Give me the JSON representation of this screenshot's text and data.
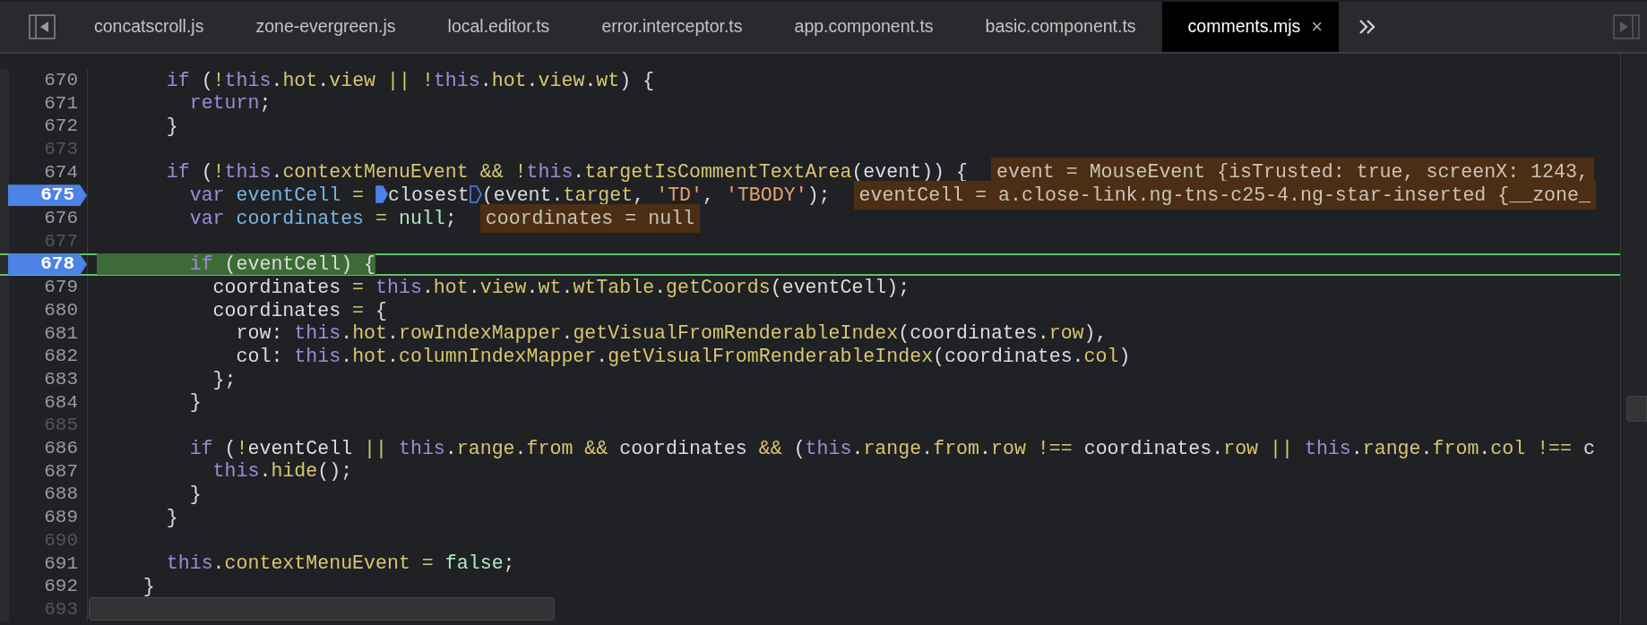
{
  "tabs": [
    {
      "label": "concatscroll.js",
      "selected": false
    },
    {
      "label": "zone-evergreen.js",
      "selected": false
    },
    {
      "label": "local.editor.ts",
      "selected": false
    },
    {
      "label": "error.interceptor.ts",
      "selected": false
    },
    {
      "label": "app.component.ts",
      "selected": false
    },
    {
      "label": "basic.component.ts",
      "selected": false
    },
    {
      "label": "comments.mjs",
      "selected": true,
      "close": "×"
    }
  ],
  "lines": [
    {
      "number": "670",
      "breakpoint": false,
      "current": false,
      "tokens": [
        {
          "kind": "keyword",
          "text": "      if"
        },
        {
          "kind": "plain",
          "text": " ("
        },
        {
          "kind": "operator",
          "text": "!"
        },
        {
          "kind": "keyword",
          "text": "this"
        },
        {
          "kind": "plain",
          "text": "."
        },
        {
          "kind": "property",
          "text": "hot"
        },
        {
          "kind": "plain",
          "text": "."
        },
        {
          "kind": "property",
          "text": "view"
        },
        {
          "kind": "operator",
          "text": " || !"
        },
        {
          "kind": "keyword",
          "text": "this"
        },
        {
          "kind": "plain",
          "text": "."
        },
        {
          "kind": "property",
          "text": "hot"
        },
        {
          "kind": "plain",
          "text": "."
        },
        {
          "kind": "property",
          "text": "view"
        },
        {
          "kind": "plain",
          "text": "."
        },
        {
          "kind": "property",
          "text": "wt"
        },
        {
          "kind": "plain",
          "text": ") {"
        }
      ]
    },
    {
      "number": "671",
      "breakpoint": false,
      "current": false,
      "tokens": [
        {
          "kind": "keyword",
          "text": "        return"
        },
        {
          "kind": "plain",
          "text": ";"
        }
      ]
    },
    {
      "number": "672",
      "breakpoint": false,
      "current": false,
      "tokens": [
        {
          "kind": "plain",
          "text": "      }"
        }
      ]
    },
    {
      "number": "673",
      "breakpoint": false,
      "current": false
    },
    {
      "number": "674",
      "breakpoint": false,
      "current": false,
      "tokens": [
        {
          "kind": "keyword",
          "text": "      if"
        },
        {
          "kind": "plain",
          "text": " ("
        },
        {
          "kind": "operator",
          "text": "!"
        },
        {
          "kind": "keyword",
          "text": "this"
        },
        {
          "kind": "plain",
          "text": "."
        },
        {
          "kind": "property",
          "text": "contextMenuEvent"
        },
        {
          "kind": "operator",
          "text": " && !"
        },
        {
          "kind": "keyword",
          "text": "this"
        },
        {
          "kind": "plain",
          "text": "."
        },
        {
          "kind": "property",
          "text": "targetIsCommentTextArea"
        },
        {
          "kind": "plain",
          "text": "(event)) {"
        }
      ],
      "value": "event = MouseEvent {isTrusted: true, screenX: 1243,"
    },
    {
      "number": "675",
      "breakpoint": true,
      "current": false,
      "tokens": [
        {
          "kind": "keyword",
          "text": "        var "
        },
        {
          "kind": "declaration",
          "text": "eventCell"
        },
        {
          "kind": "operator",
          "text": " = "
        },
        {
          "kind": "inline_breakpoint",
          "active": true
        },
        {
          "kind": "plain",
          "text": "closest"
        },
        {
          "kind": "inline_breakpoint",
          "active": false
        },
        {
          "kind": "plain",
          "text": "(event."
        },
        {
          "kind": "property",
          "text": "target"
        },
        {
          "kind": "plain",
          "text": ", "
        },
        {
          "kind": "string",
          "text": "'TD'"
        },
        {
          "kind": "plain",
          "text": ", "
        },
        {
          "kind": "string",
          "text": "'TBODY'"
        },
        {
          "kind": "plain",
          "text": ");"
        }
      ],
      "value": "eventCell = a.close-link.ng-tns-c25-4.ng-star-inserted {__zone_"
    },
    {
      "number": "676",
      "breakpoint": false,
      "current": false,
      "tokens": [
        {
          "kind": "keyword",
          "text": "        var "
        },
        {
          "kind": "declaration",
          "text": "coordinates"
        },
        {
          "kind": "operator",
          "text": " = "
        },
        {
          "kind": "literal",
          "text": "null"
        },
        {
          "kind": "plain",
          "text": ";"
        }
      ],
      "value": "coordinates = null"
    },
    {
      "number": "677",
      "breakpoint": false,
      "current": false
    },
    {
      "number": "678",
      "breakpoint": true,
      "current": true,
      "tokens": [
        {
          "kind": "keyword",
          "text": "        if"
        },
        {
          "kind": "plain",
          "text": " (eventCell) {"
        }
      ]
    },
    {
      "number": "679",
      "breakpoint": false,
      "current": false,
      "tokens": [
        {
          "kind": "plain",
          "text": "          coordinates "
        },
        {
          "kind": "operator",
          "text": "= "
        },
        {
          "kind": "keyword",
          "text": "this"
        },
        {
          "kind": "plain",
          "text": "."
        },
        {
          "kind": "property",
          "text": "hot"
        },
        {
          "kind": "plain",
          "text": "."
        },
        {
          "kind": "property",
          "text": "view"
        },
        {
          "kind": "plain",
          "text": "."
        },
        {
          "kind": "property",
          "text": "wt"
        },
        {
          "kind": "plain",
          "text": "."
        },
        {
          "kind": "property",
          "text": "wtTable"
        },
        {
          "kind": "plain",
          "text": "."
        },
        {
          "kind": "property",
          "text": "getCoords"
        },
        {
          "kind": "plain",
          "text": "(eventCell);"
        }
      ]
    },
    {
      "number": "680",
      "breakpoint": false,
      "current": false,
      "tokens": [
        {
          "kind": "plain",
          "text": "          coordinates "
        },
        {
          "kind": "operator",
          "text": "="
        },
        {
          "kind": "plain",
          "text": " {"
        }
      ]
    },
    {
      "number": "681",
      "breakpoint": false,
      "current": false,
      "tokens": [
        {
          "kind": "plain",
          "text": "            row: "
        },
        {
          "kind": "keyword",
          "text": "this"
        },
        {
          "kind": "plain",
          "text": "."
        },
        {
          "kind": "property",
          "text": "hot"
        },
        {
          "kind": "plain",
          "text": "."
        },
        {
          "kind": "property",
          "text": "rowIndexMapper"
        },
        {
          "kind": "plain",
          "text": "."
        },
        {
          "kind": "property",
          "text": "getVisualFromRenderableIndex"
        },
        {
          "kind": "plain",
          "text": "(coordinates."
        },
        {
          "kind": "property",
          "text": "row"
        },
        {
          "kind": "plain",
          "text": "),"
        }
      ]
    },
    {
      "number": "682",
      "breakpoint": false,
      "current": false,
      "tokens": [
        {
          "kind": "plain",
          "text": "            col: "
        },
        {
          "kind": "keyword",
          "text": "this"
        },
        {
          "kind": "plain",
          "text": "."
        },
        {
          "kind": "property",
          "text": "hot"
        },
        {
          "kind": "plain",
          "text": "."
        },
        {
          "kind": "property",
          "text": "columnIndexMapper"
        },
        {
          "kind": "plain",
          "text": "."
        },
        {
          "kind": "property",
          "text": "getVisualFromRenderableIndex"
        },
        {
          "kind": "plain",
          "text": "(coordinates."
        },
        {
          "kind": "property",
          "text": "col"
        },
        {
          "kind": "plain",
          "text": ")"
        }
      ]
    },
    {
      "number": "683",
      "breakpoint": false,
      "current": false,
      "tokens": [
        {
          "kind": "plain",
          "text": "          };"
        }
      ]
    },
    {
      "number": "684",
      "breakpoint": false,
      "current": false,
      "tokens": [
        {
          "kind": "plain",
          "text": "        }"
        }
      ]
    },
    {
      "number": "685",
      "breakpoint": false,
      "current": false
    },
    {
      "number": "686",
      "breakpoint": false,
      "current": false,
      "tokens": [
        {
          "kind": "keyword",
          "text": "        if"
        },
        {
          "kind": "plain",
          "text": " ("
        },
        {
          "kind": "operator",
          "text": "!"
        },
        {
          "kind": "plain",
          "text": "eventCell "
        },
        {
          "kind": "operator",
          "text": "|| "
        },
        {
          "kind": "keyword",
          "text": "this"
        },
        {
          "kind": "plain",
          "text": "."
        },
        {
          "kind": "property",
          "text": "range"
        },
        {
          "kind": "plain",
          "text": "."
        },
        {
          "kind": "property",
          "text": "from"
        },
        {
          "kind": "operator",
          "text": " && "
        },
        {
          "kind": "plain",
          "text": "coordinates "
        },
        {
          "kind": "operator",
          "text": "&&"
        },
        {
          "kind": "plain",
          "text": " ("
        },
        {
          "kind": "keyword",
          "text": "this"
        },
        {
          "kind": "plain",
          "text": "."
        },
        {
          "kind": "property",
          "text": "range"
        },
        {
          "kind": "plain",
          "text": "."
        },
        {
          "kind": "property",
          "text": "from"
        },
        {
          "kind": "plain",
          "text": "."
        },
        {
          "kind": "property",
          "text": "row"
        },
        {
          "kind": "operator",
          "text": " !== "
        },
        {
          "kind": "plain",
          "text": "coordinates."
        },
        {
          "kind": "property",
          "text": "row"
        },
        {
          "kind": "operator",
          "text": " || "
        },
        {
          "kind": "keyword",
          "text": "this"
        },
        {
          "kind": "plain",
          "text": "."
        },
        {
          "kind": "property",
          "text": "range"
        },
        {
          "kind": "plain",
          "text": "."
        },
        {
          "kind": "property",
          "text": "from"
        },
        {
          "kind": "plain",
          "text": "."
        },
        {
          "kind": "property",
          "text": "col"
        },
        {
          "kind": "operator",
          "text": " !== "
        },
        {
          "kind": "plain",
          "text": "c"
        }
      ]
    },
    {
      "number": "687",
      "breakpoint": false,
      "current": false,
      "tokens": [
        {
          "kind": "keyword",
          "text": "          this"
        },
        {
          "kind": "plain",
          "text": "."
        },
        {
          "kind": "property",
          "text": "hide"
        },
        {
          "kind": "plain",
          "text": "();"
        }
      ]
    },
    {
      "number": "688",
      "breakpoint": false,
      "current": false,
      "tokens": [
        {
          "kind": "plain",
          "text": "        }"
        }
      ]
    },
    {
      "number": "689",
      "breakpoint": false,
      "current": false,
      "tokens": [
        {
          "kind": "plain",
          "text": "      }"
        }
      ]
    },
    {
      "number": "690",
      "breakpoint": false,
      "current": false
    },
    {
      "number": "691",
      "breakpoint": false,
      "current": false,
      "tokens": [
        {
          "kind": "keyword",
          "text": "      this"
        },
        {
          "kind": "plain",
          "text": "."
        },
        {
          "kind": "property",
          "text": "contextMenuEvent"
        },
        {
          "kind": "operator",
          "text": " = "
        },
        {
          "kind": "literal",
          "text": "false"
        },
        {
          "kind": "plain",
          "text": ";"
        }
      ]
    },
    {
      "number": "692",
      "breakpoint": false,
      "current": false,
      "tokens": [
        {
          "kind": "plain",
          "text": "    }"
        }
      ]
    },
    {
      "number": "693",
      "breakpoint": false,
      "current": false
    }
  ]
}
